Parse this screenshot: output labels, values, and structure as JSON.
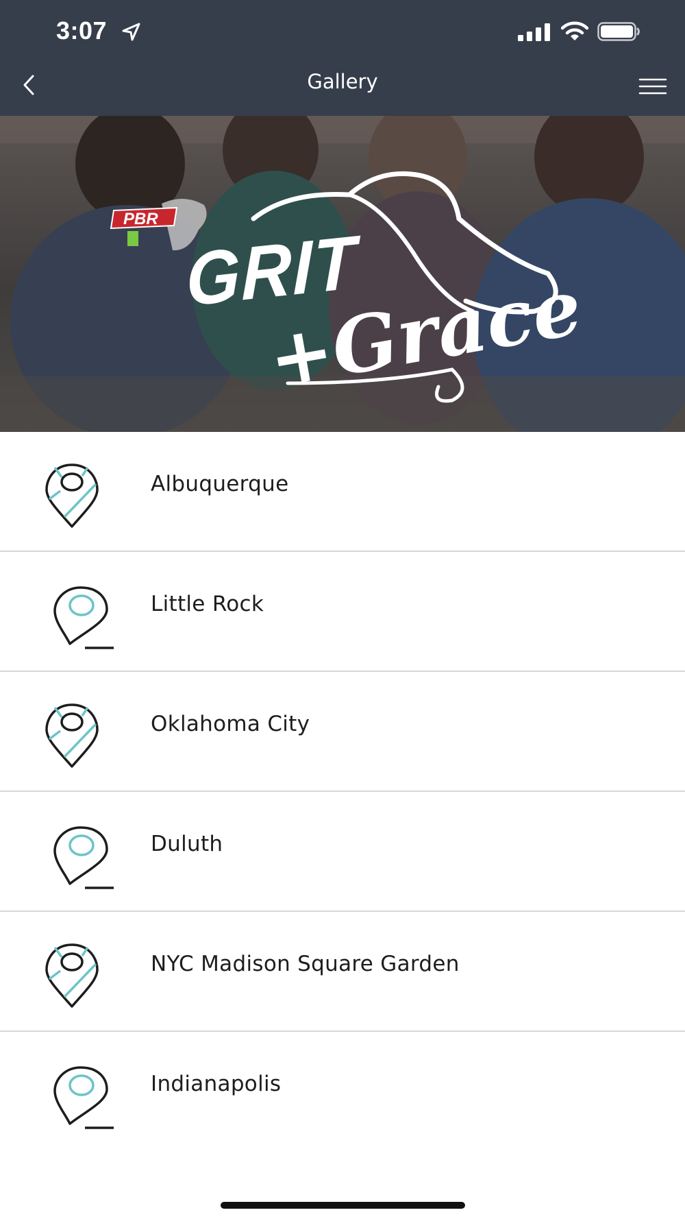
{
  "status_bar": {
    "time": "3:07",
    "location_icon": "location-arrow-icon",
    "signal_icon": "cellular-signal-icon",
    "wifi_icon": "wifi-icon",
    "battery_icon": "battery-icon"
  },
  "nav": {
    "title": "Gallery",
    "back_icon": "chevron-left-icon",
    "menu_icon": "hamburger-menu-icon"
  },
  "hero": {
    "title_line1": "GRIT",
    "title_line2": "+Grace",
    "logo": "PBR Unleash the Beast logo"
  },
  "locations": [
    {
      "label": "Albuquerque",
      "icon": "map-pin-route-icon"
    },
    {
      "label": "Little Rock",
      "icon": "map-pin-circle-icon"
    },
    {
      "label": "Oklahoma City",
      "icon": "map-pin-route-icon"
    },
    {
      "label": "Duluth",
      "icon": "map-pin-circle-icon"
    },
    {
      "label": "NYC Madison Square Garden",
      "icon": "map-pin-route-icon"
    },
    {
      "label": "Indianapolis",
      "icon": "map-pin-circle-icon"
    }
  ],
  "colors": {
    "header_bg": "#363d4b",
    "accent_teal": "#6cc4c8",
    "text_dark": "#1d1d1d",
    "divider": "#d6d6d6"
  }
}
